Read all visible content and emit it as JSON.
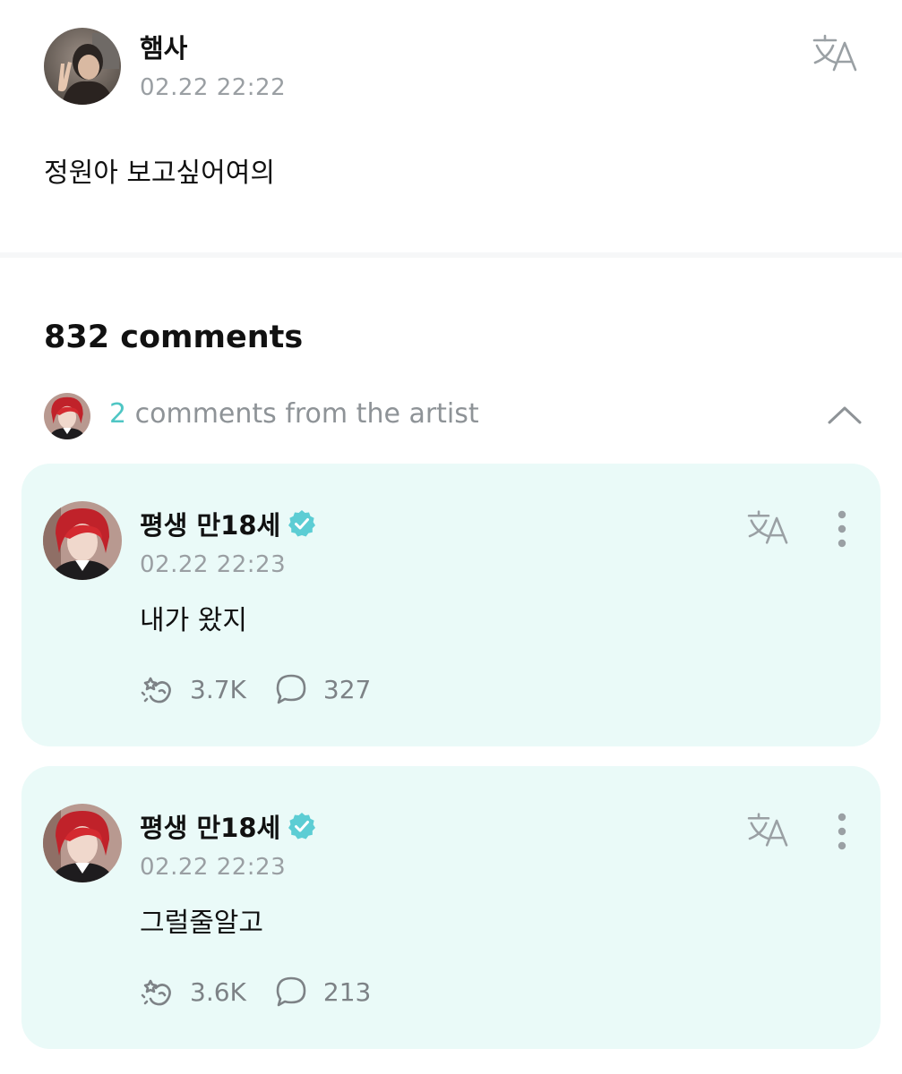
{
  "post": {
    "author": "햄사",
    "time": "02.22 22:22",
    "body": "정원아 보고싶어여의",
    "translate_icon": "translate-icon"
  },
  "comments_header": {
    "count_label": "832 comments"
  },
  "artist_row": {
    "count": "2",
    "label": " comments from the artist",
    "toggle_icon": "chevron-up-icon"
  },
  "artist_comments": [
    {
      "author": "평생 만18세",
      "verified": true,
      "time": "02.22 22:23",
      "text": "내가 왔지",
      "likes": "3.7K",
      "replies": "327"
    },
    {
      "author": "평생 만18세",
      "verified": true,
      "time": "02.22 22:23",
      "text": "그럴줄알고",
      "likes": "3.6K",
      "replies": "213"
    }
  ],
  "colors": {
    "accent": "#4fc6c4",
    "card_background": "#eafaf8",
    "muted_text": "#9a9fa3",
    "icon_gray": "#7d8286"
  }
}
